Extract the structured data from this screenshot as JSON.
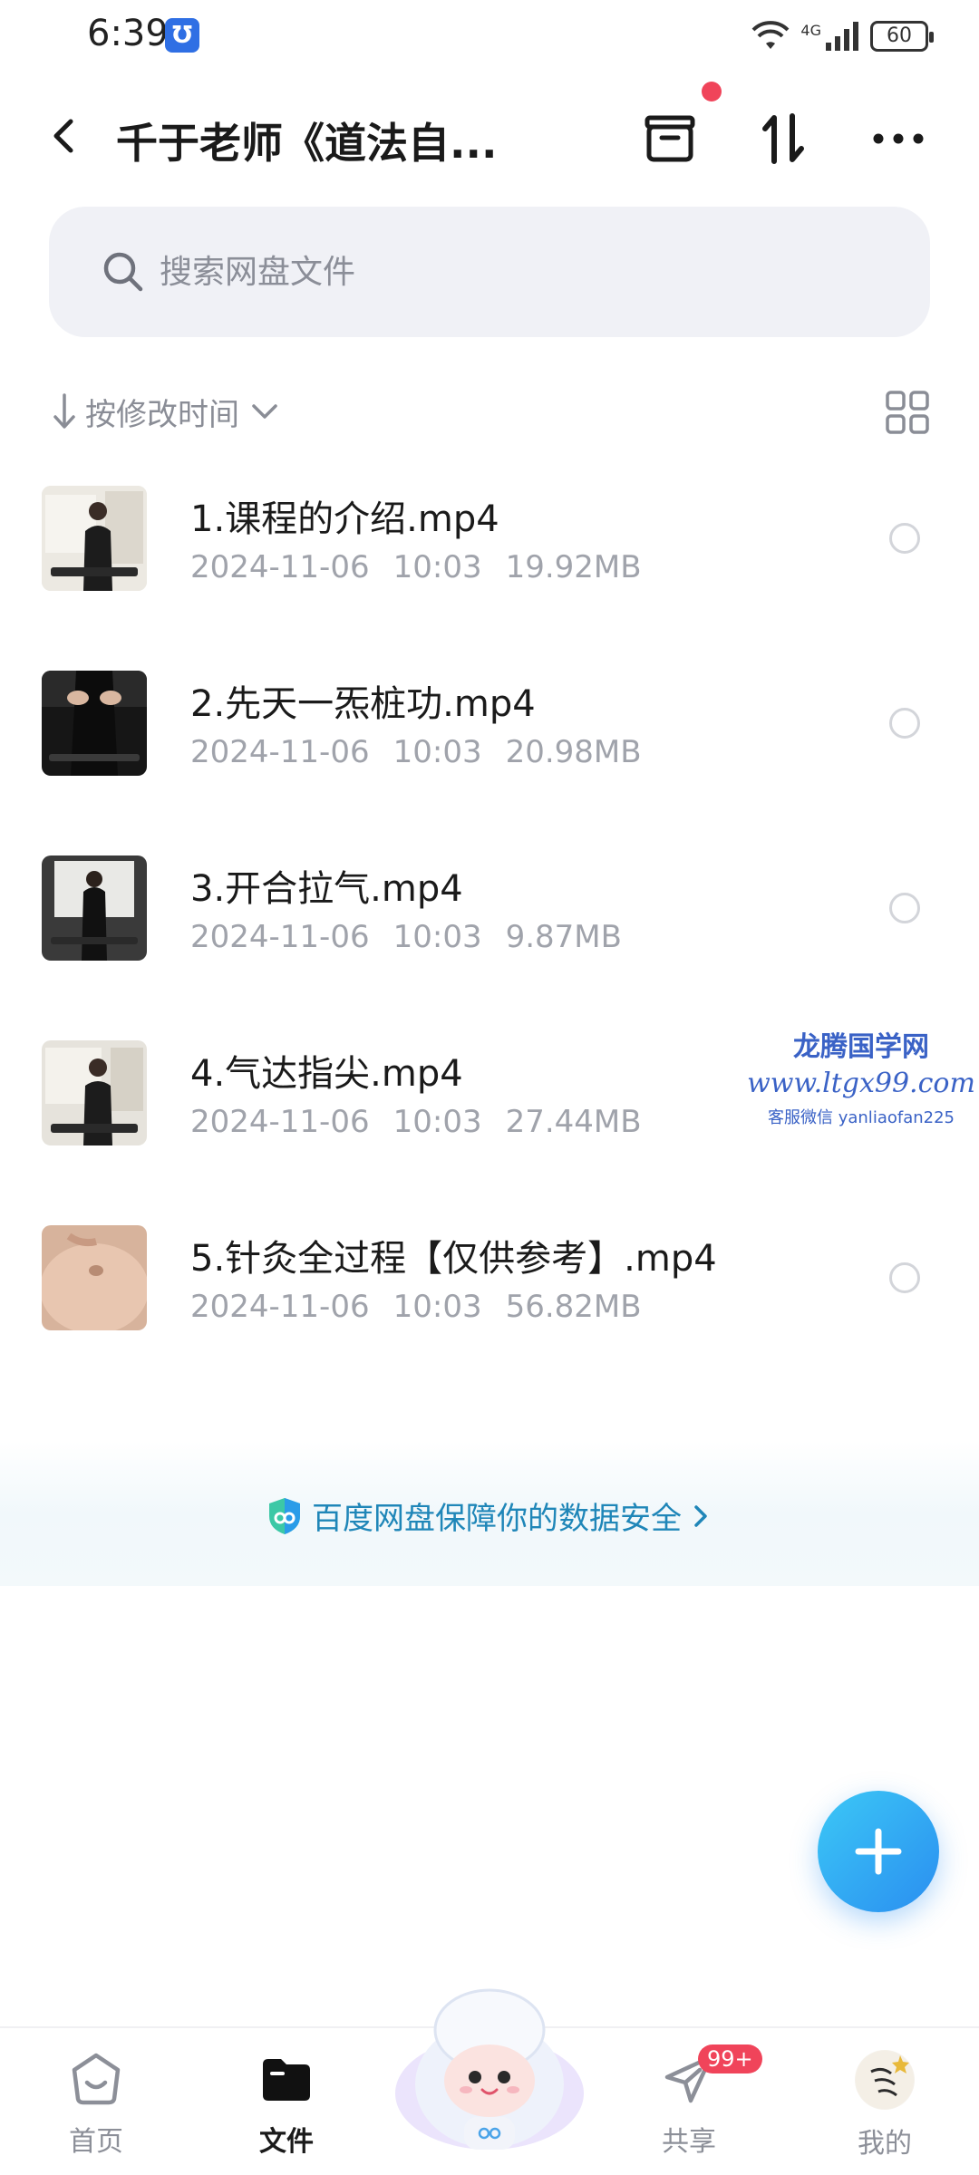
{
  "status_bar": {
    "time": "6:39",
    "network": "4G",
    "battery": "60"
  },
  "header": {
    "title": "千于老师《道法自...",
    "icons": [
      "back-icon",
      "archive-icon",
      "sort-transfer-icon",
      "more-icon"
    ]
  },
  "search": {
    "placeholder": "搜索网盘文件"
  },
  "sort": {
    "label": "按修改时间"
  },
  "files": [
    {
      "name": "1.课程的介绍.mp4",
      "date": "2024-11-06",
      "time": "10:03",
      "size": "19.92MB"
    },
    {
      "name": "2.先天一炁桩功.mp4",
      "date": "2024-11-06",
      "time": "10:03",
      "size": "20.98MB"
    },
    {
      "name": "3.开合拉气.mp4",
      "date": "2024-11-06",
      "time": "10:03",
      "size": "9.87MB"
    },
    {
      "name": "4.气达指尖.mp4",
      "date": "2024-11-06",
      "time": "10:03",
      "size": "27.44MB"
    },
    {
      "name": "5.针灸全过程【仅供参考】.mp4",
      "date": "2024-11-06",
      "time": "10:03",
      "size": "56.82MB"
    }
  ],
  "watermark": {
    "line1": "龙腾国学网",
    "line2": "www.ltgx99.com",
    "line3": "客服微信 yanliaofan225"
  },
  "security_banner": {
    "text": "百度网盘保障你的数据安全"
  },
  "bottom_nav": {
    "items": [
      {
        "label": "首页",
        "icon": "home-icon"
      },
      {
        "label": "文件",
        "icon": "folder-icon"
      },
      {
        "label": "共享",
        "icon": "share-icon",
        "badge": "99+"
      },
      {
        "label": "我的",
        "icon": "avatar"
      }
    ]
  },
  "colors": {
    "accent": "#2a8ef0",
    "security_text": "#1f86b8",
    "badge": "#f0445a"
  }
}
